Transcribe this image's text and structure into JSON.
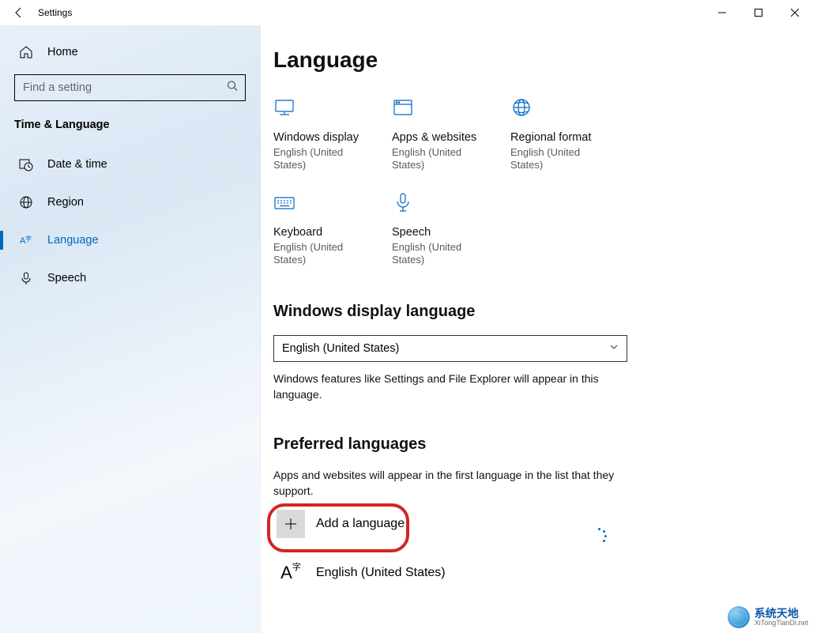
{
  "window": {
    "title": "Settings"
  },
  "sidebar": {
    "home": "Home",
    "searchPlaceholder": "Find a setting",
    "category": "Time & Language",
    "items": [
      {
        "key": "date",
        "label": "Date & time"
      },
      {
        "key": "region",
        "label": "Region"
      },
      {
        "key": "language",
        "label": "Language",
        "selected": true
      },
      {
        "key": "speech",
        "label": "Speech"
      }
    ]
  },
  "page": {
    "title": "Language",
    "tiles": [
      {
        "key": "display",
        "title": "Windows display",
        "sub": "English (United States)"
      },
      {
        "key": "apps",
        "title": "Apps & websites",
        "sub": "English (United States)"
      },
      {
        "key": "regional",
        "title": "Regional format",
        "sub": "English (United States)"
      },
      {
        "key": "keyboard",
        "title": "Keyboard",
        "sub": "English (United States)"
      },
      {
        "key": "speech",
        "title": "Speech",
        "sub": "English (United States)"
      }
    ],
    "displayLang": {
      "heading": "Windows display language",
      "value": "English (United States)",
      "hint": "Windows features like Settings and File Explorer will appear in this language."
    },
    "preferred": {
      "heading": "Preferred languages",
      "hint": "Apps and websites will appear in the first language in the list that they support.",
      "addLabel": "Add a language",
      "items": [
        {
          "label": "English (United States)"
        }
      ]
    }
  },
  "watermark": {
    "title": "系统天地",
    "sub": "XiTongTianDi.net"
  }
}
